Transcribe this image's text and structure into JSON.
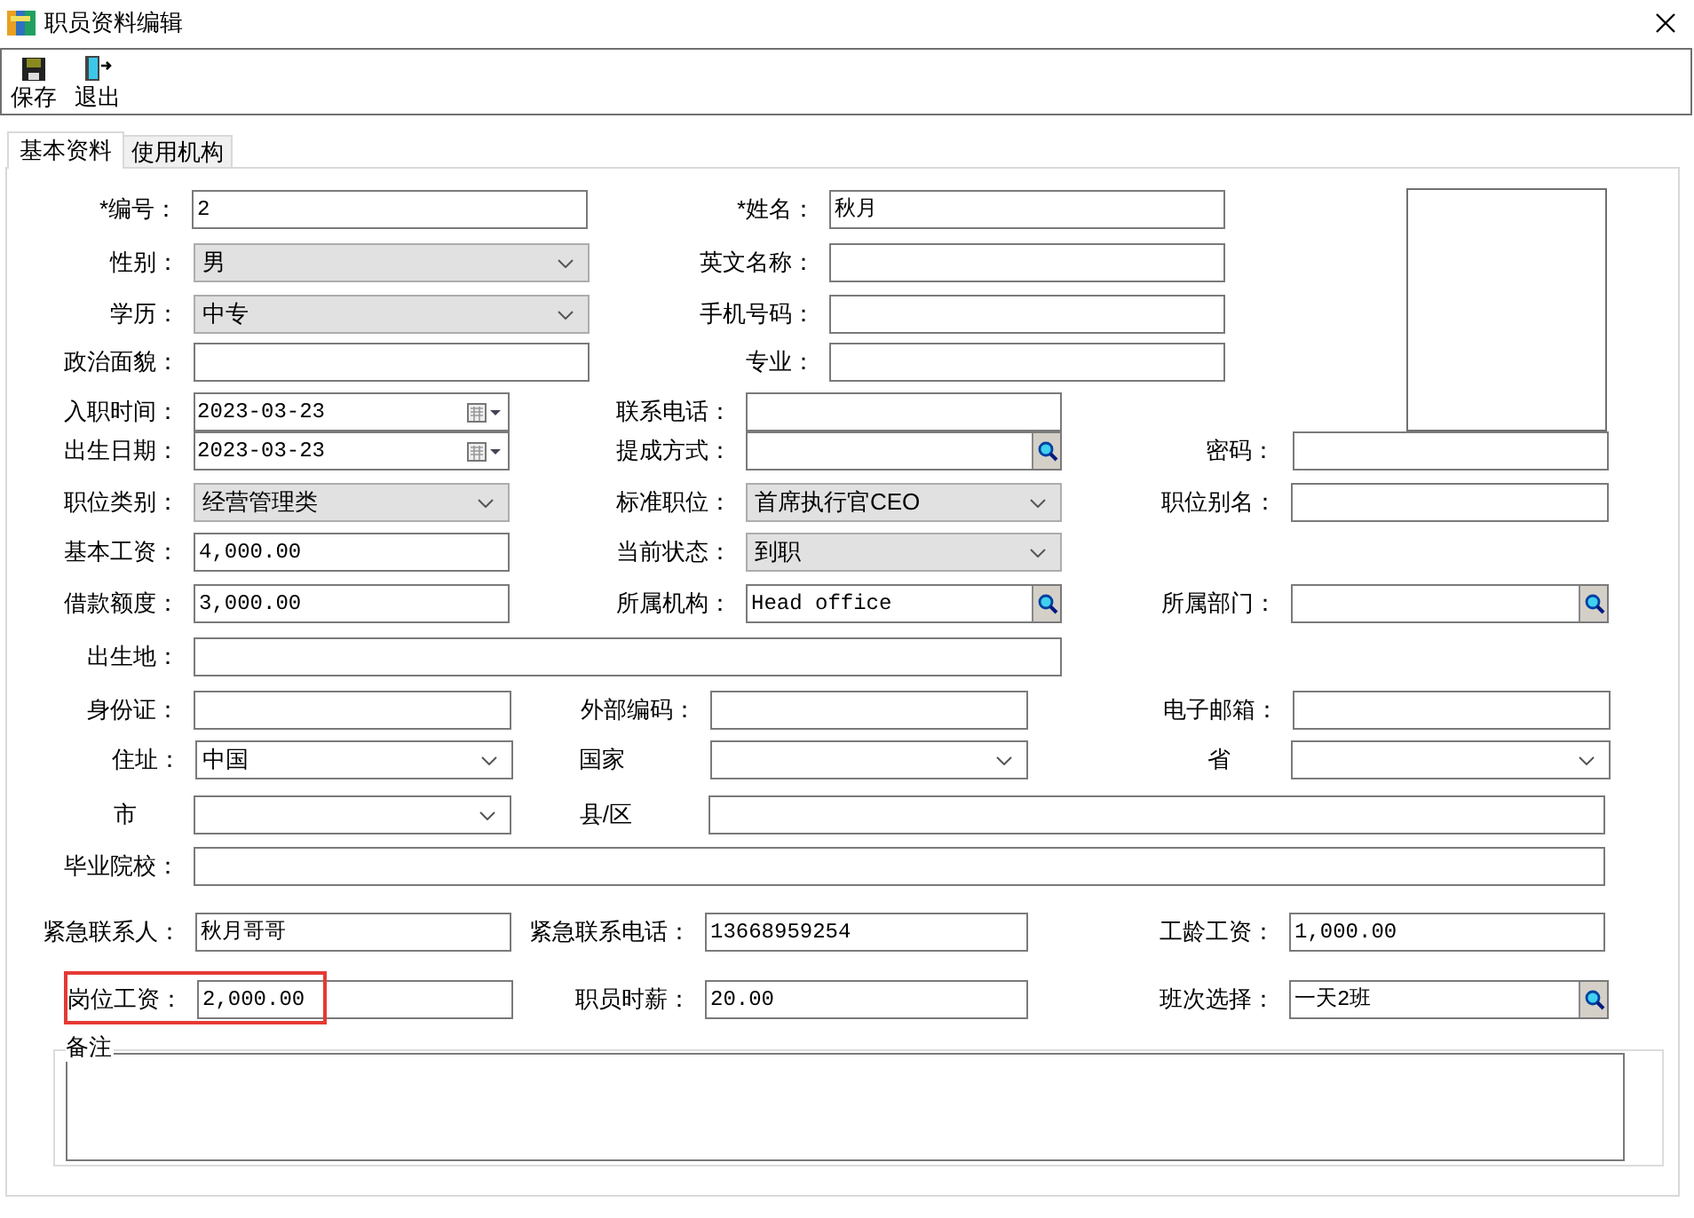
{
  "window": {
    "title": "职员资料编辑"
  },
  "toolbar": [
    {
      "label": "保存",
      "kind": "save"
    },
    {
      "label": "退出",
      "kind": "exit"
    }
  ],
  "tabs": [
    {
      "label": "基本资料",
      "selected": true
    },
    {
      "label": "使用机构",
      "selected": false
    }
  ],
  "form_rows": [
    {
      "fields": [
        {
          "label": "*编号：",
          "kind": "text",
          "value": "2",
          "highlighted": false
        },
        {
          "label": "*姓名：",
          "kind": "text",
          "value": "秋月",
          "highlighted": false
        }
      ]
    },
    {
      "fields": [
        {
          "label": "性别：",
          "kind": "select",
          "value": "男",
          "highlighted": false
        },
        {
          "label": "英文名称：",
          "kind": "text",
          "highlighted": false
        }
      ]
    },
    {
      "fields": [
        {
          "label": "学历：",
          "kind": "select",
          "value": "中专",
          "highlighted": false
        },
        {
          "label": "手机号码：",
          "kind": "text",
          "highlighted": false
        }
      ]
    },
    {
      "fields": [
        {
          "label": "政治面貌：",
          "kind": "text",
          "highlighted": false
        },
        {
          "label": "专业：",
          "kind": "text",
          "highlighted": false
        }
      ]
    },
    {
      "fields": [
        {
          "label": "入职时间：",
          "kind": "date",
          "value": "2023-03-23",
          "highlighted": false
        },
        {
          "label": "联系电话：",
          "kind": "text",
          "highlighted": false
        }
      ]
    },
    {
      "fields": [
        {
          "label": "出生日期：",
          "kind": "date",
          "value": "2023-03-23",
          "highlighted": false
        },
        {
          "label": "提成方式：",
          "kind": "lookup",
          "highlighted": false
        },
        {
          "label": "密码：",
          "kind": "text",
          "highlighted": false
        }
      ]
    },
    {
      "fields": [
        {
          "label": "职位类别：",
          "kind": "select",
          "value": "经营管理类",
          "highlighted": false
        },
        {
          "label": "标准职位：",
          "kind": "select",
          "value": "首席执行官CEO",
          "highlighted": false
        },
        {
          "label": "职位别名：",
          "kind": "text",
          "highlighted": false
        }
      ]
    },
    {
      "fields": [
        {
          "label": "基本工资：",
          "kind": "text",
          "value": "4,000.00",
          "highlighted": false
        },
        {
          "label": "当前状态：",
          "kind": "select",
          "value": "到职",
          "highlighted": false
        }
      ]
    },
    {
      "fields": [
        {
          "label": "借款额度：",
          "kind": "text",
          "value": "3,000.00",
          "highlighted": false
        },
        {
          "label": "所属机构：",
          "kind": "lookup",
          "value": "Head office",
          "highlighted": false
        },
        {
          "label": "所属部门：",
          "kind": "lookup",
          "highlighted": false
        }
      ]
    },
    {
      "fields": [
        {
          "label": "出生地：",
          "kind": "text",
          "highlighted": false
        }
      ]
    },
    {
      "fields": [
        {
          "label": "身份证：",
          "kind": "text",
          "highlighted": false
        },
        {
          "label": "外部编码：",
          "kind": "text",
          "highlighted": false
        },
        {
          "label": "电子邮箱：",
          "kind": "text",
          "highlighted": false
        }
      ]
    },
    {
      "fields": [
        {
          "label": "住址：",
          "kind": "combo",
          "value": "中国",
          "highlighted": false
        },
        {
          "label": "国家",
          "kind": "combo",
          "highlighted": false
        },
        {
          "label": "省",
          "kind": "combo",
          "highlighted": false
        }
      ]
    },
    {
      "fields": [
        {
          "label": "市",
          "kind": "combo",
          "highlighted": false
        },
        {
          "label": "县/区",
          "kind": "text",
          "highlighted": false
        }
      ]
    },
    {
      "fields": [
        {
          "label": "毕业院校：",
          "kind": "text",
          "highlighted": false
        }
      ]
    },
    {
      "fields": [
        {
          "label": "紧急联系人：",
          "kind": "text",
          "value": "秋月哥哥",
          "highlighted": false
        },
        {
          "label": "紧急联系电话：",
          "kind": "text",
          "value": "13668959254",
          "highlighted": false
        },
        {
          "label": "工龄工资：",
          "kind": "text",
          "value": "1,000.00",
          "highlighted": false
        }
      ]
    },
    {
      "fields": [
        {
          "label": "岗位工资：",
          "kind": "text",
          "value": "2,000.00",
          "highlighted": true
        },
        {
          "label": "职员时薪：",
          "kind": "text",
          "value": "20.00",
          "highlighted": false
        },
        {
          "label": "班次选择：",
          "kind": "lookup",
          "value": "一天2班",
          "highlighted": false
        }
      ]
    }
  ],
  "notes": {
    "label": "备注"
  }
}
